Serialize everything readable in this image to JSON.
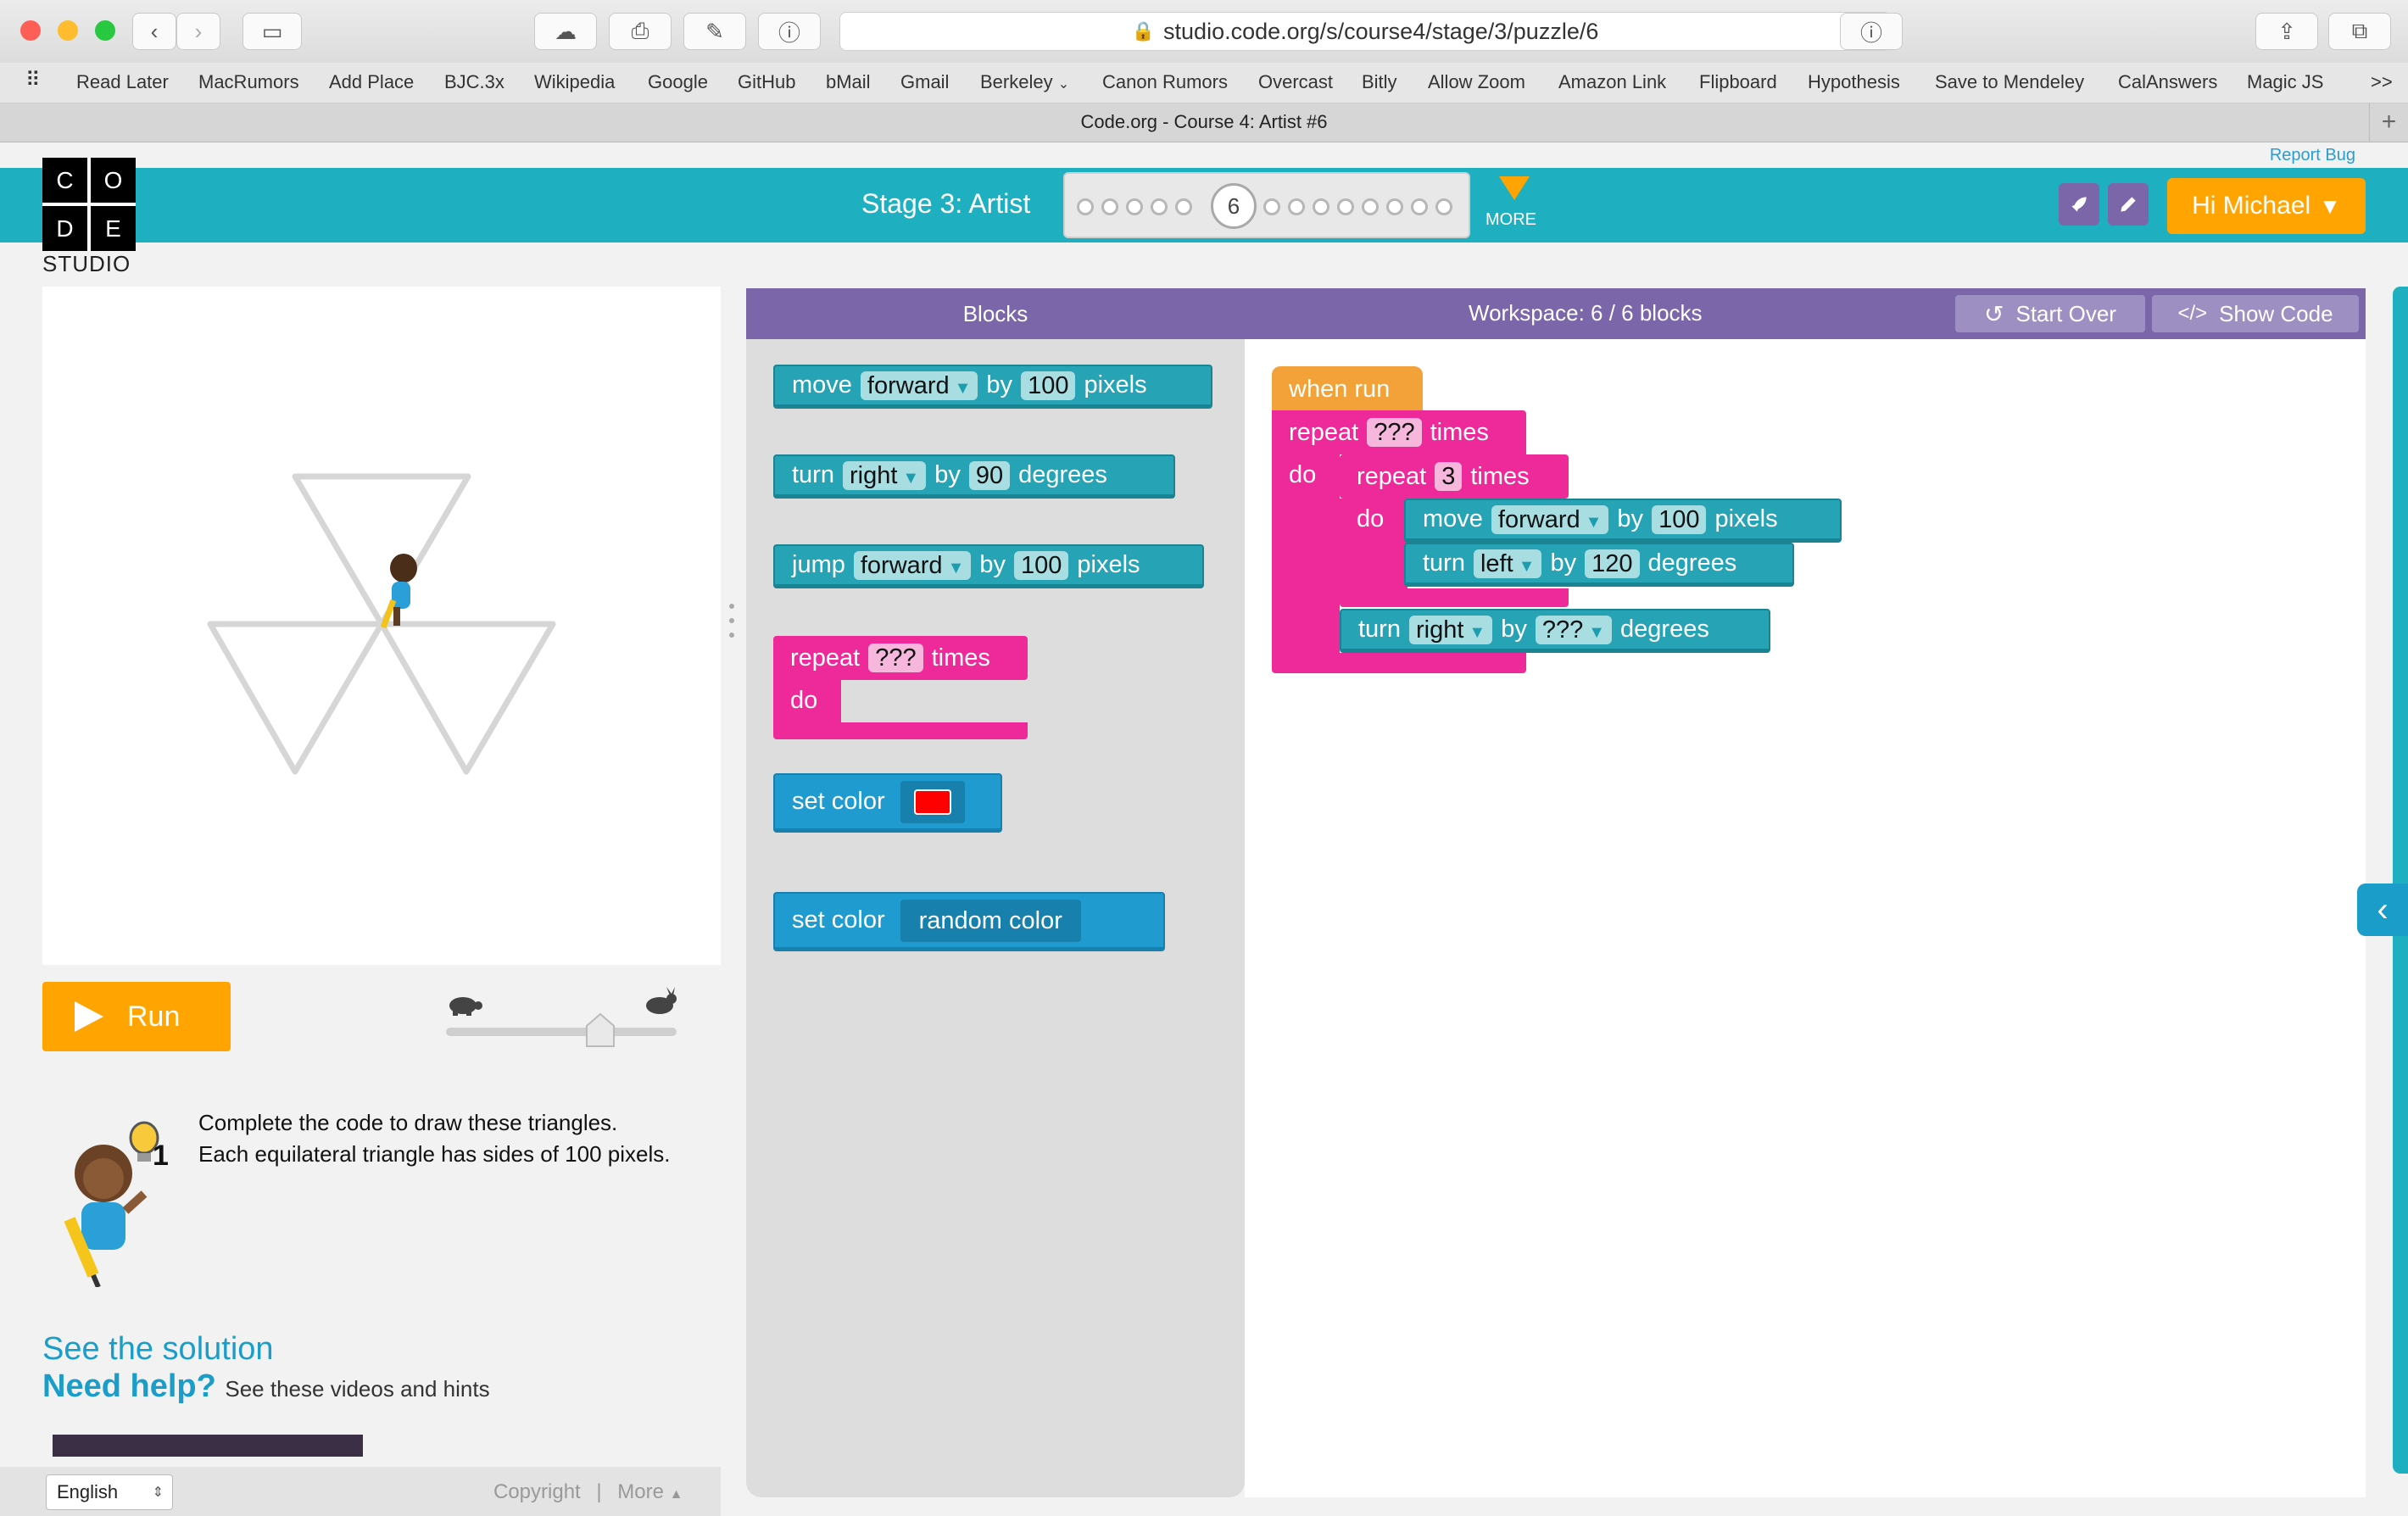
{
  "browser": {
    "url": "studio.code.org/s/course4/stage/3/puzzle/6",
    "tab_title": "Code.org - Course 4: Artist #6",
    "bookmarks": [
      "Read Later",
      "MacRumors",
      "Add Place",
      "BJC.3x",
      "Wikipedia",
      "Google",
      "GitHub",
      "bMail",
      "Gmail",
      "Berkeley",
      "Canon Rumors",
      "Overcast",
      "Bitly",
      "Allow Zoom",
      "Amazon Link",
      "Flipboard",
      "Hypothesis",
      "Save to Mendeley",
      "CalAnswers",
      "Magic JS"
    ],
    "overflow": ">>"
  },
  "header": {
    "logo_letters": [
      "C",
      "O",
      "D",
      "E"
    ],
    "logo_sub": "STUDIO",
    "report_bug": "Report Bug",
    "stage_title": "Stage 3: Artist",
    "current_puzzle": "6",
    "more": "MORE",
    "user": "Hi Michael"
  },
  "left": {
    "run": "Run",
    "instructions_line1": "Complete the code to draw these triangles.",
    "instructions_line2": "Each equilateral triangle has sides of 100 pixels.",
    "hint_count": "1",
    "see_solution": "See the solution",
    "need_help": "Need help?",
    "need_help_sub": "See these videos and hints",
    "language": "English",
    "copyright": "Copyright",
    "more": "More"
  },
  "blocks_panel": {
    "title": "Blocks",
    "toolbox": {
      "move": {
        "verb": "move",
        "dir": "forward",
        "by": "by",
        "val": "100",
        "unit": "pixels"
      },
      "turn": {
        "verb": "turn",
        "dir": "right",
        "by": "by",
        "val": "90",
        "unit": "degrees"
      },
      "jump": {
        "verb": "jump",
        "dir": "forward",
        "by": "by",
        "val": "100",
        "unit": "pixels"
      },
      "repeat": {
        "verb": "repeat",
        "val": "???",
        "unit": "times",
        "do": "do"
      },
      "setcolor1": {
        "label": "set color"
      },
      "setcolor2": {
        "label": "set color",
        "value": "random color"
      }
    }
  },
  "workspace": {
    "title": "Workspace: 6 / 6 blocks",
    "start_over": "Start Over",
    "show_code": "Show Code",
    "when_run": "when run",
    "outer_repeat": {
      "verb": "repeat",
      "val": "???",
      "unit": "times",
      "do": "do"
    },
    "inner_repeat": {
      "verb": "repeat",
      "val": "3",
      "unit": "times",
      "do": "do"
    },
    "move": {
      "verb": "move",
      "dir": "forward",
      "by": "by",
      "val": "100",
      "unit": "pixels"
    },
    "turn_left": {
      "verb": "turn",
      "dir": "left",
      "by": "by",
      "val": "120",
      "unit": "degrees"
    },
    "turn_right": {
      "verb": "turn",
      "dir": "right",
      "by": "by",
      "val": "???",
      "unit": "degrees"
    }
  },
  "colors": {
    "teal": "#1eb0c1",
    "purple": "#7a66a8",
    "orange": "#ffa400",
    "pink": "#ee2a9b",
    "link": "#1b9dc9",
    "red_swatch": "#ff0000"
  }
}
